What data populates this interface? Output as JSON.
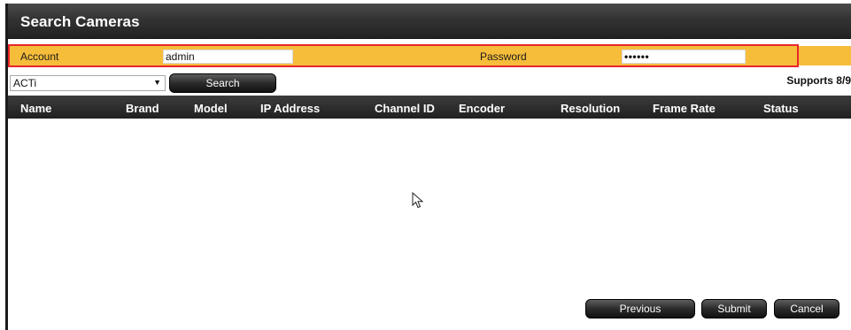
{
  "window": {
    "title": "Search Cameras"
  },
  "credentials": {
    "account_label": "Account",
    "account_value": "admin",
    "password_label": "Password",
    "password_value": "••••••"
  },
  "toolbar": {
    "brand_selected": "ACTi",
    "search_label": "Search",
    "supports_text": "Supports 8/9"
  },
  "table": {
    "columns": [
      "Name",
      "Brand",
      "Model",
      "IP Address",
      "Channel ID",
      "Encoder",
      "Resolution",
      "Frame Rate",
      "Status"
    ],
    "rows": []
  },
  "footer": {
    "previous_label": "Previous",
    "submit_label": "Submit",
    "cancel_label": "Cancel"
  },
  "colors": {
    "credentials_bar": "#f6bd3b",
    "highlight_border": "#e8262c",
    "header_dark": "#2a2a2a"
  },
  "icons": [
    "pointer-cursor-icon",
    "dropdown-arrow-icon"
  ]
}
